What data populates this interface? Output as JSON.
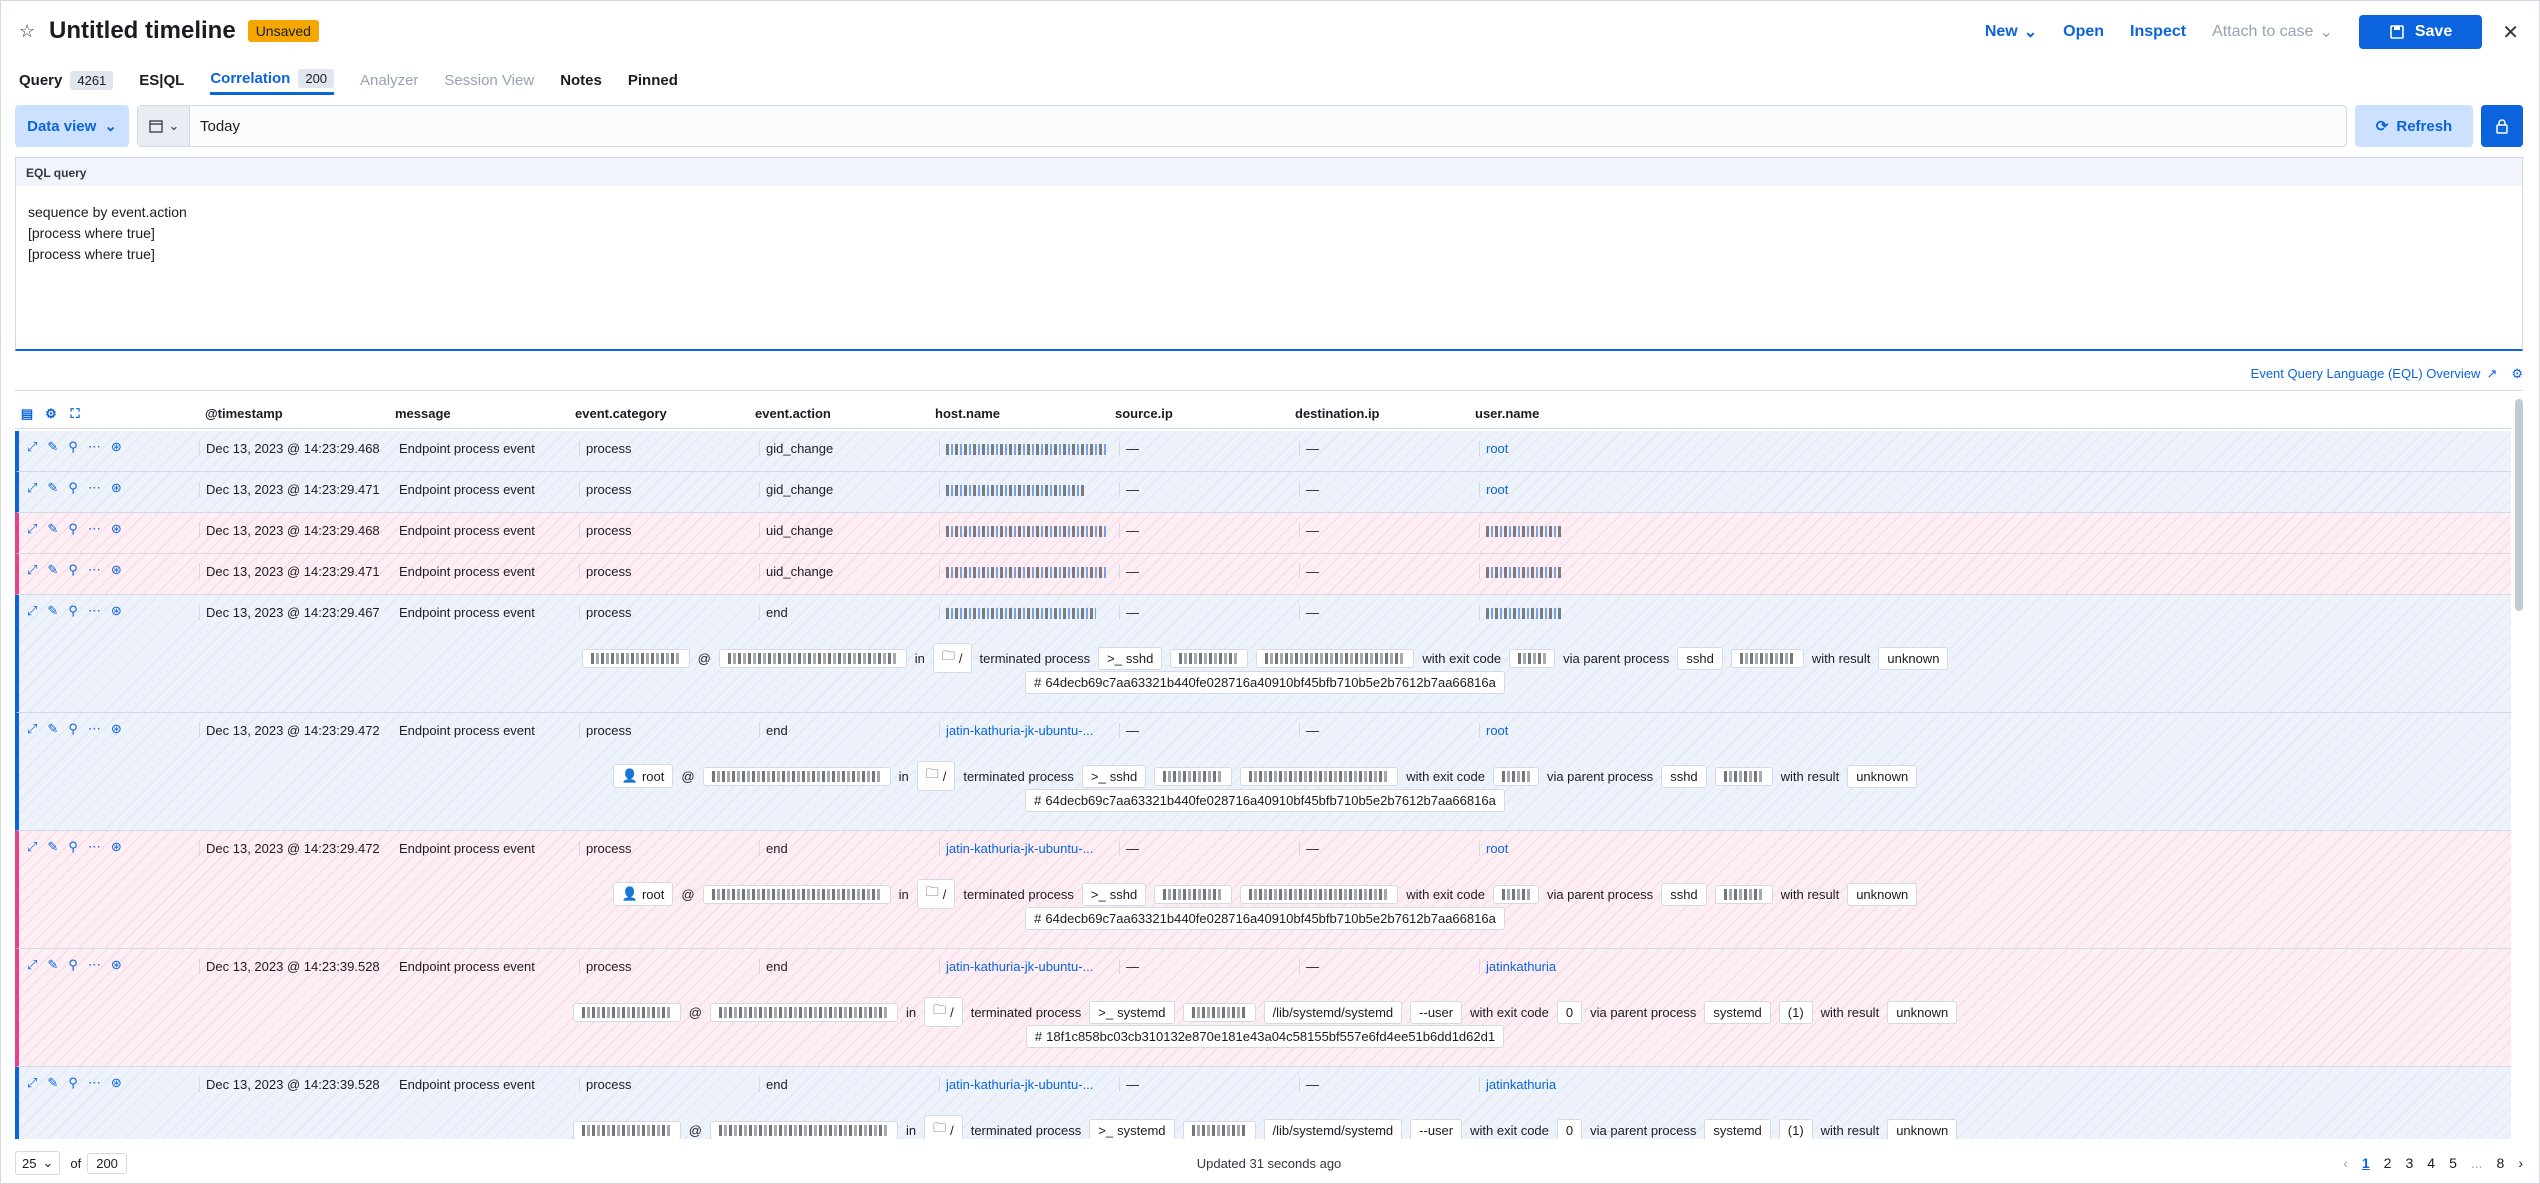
{
  "header": {
    "title": "Untitled timeline",
    "unsaved_badge": "Unsaved",
    "new_label": "New",
    "open_label": "Open",
    "inspect_label": "Inspect",
    "attach_label": "Attach to case",
    "save_label": "Save"
  },
  "tabs": [
    {
      "label": "Query",
      "count": "4261"
    },
    {
      "label": "ES|QL"
    },
    {
      "label": "Correlation",
      "count": "200"
    },
    {
      "label": "Analyzer"
    },
    {
      "label": "Session View"
    },
    {
      "label": "Notes"
    },
    {
      "label": "Pinned"
    }
  ],
  "query_bar": {
    "data_view_label": "Data view",
    "date_value": "Today",
    "refresh_label": "Refresh"
  },
  "eql": {
    "label": "EQL query",
    "query": "sequence by event.action\n[process where true]\n[process where true]",
    "overview_link": "Event Query Language (EQL) Overview"
  },
  "columns": [
    "@timestamp",
    "message",
    "event.category",
    "event.action",
    "host.name",
    "source.ip",
    "destination.ip",
    "user.name"
  ],
  "rows": [
    {
      "ts": "Dec 13, 2023 @ 14:23:29.468",
      "msg": "Endpoint process event",
      "cat": "process",
      "action": "gid_change",
      "host": "",
      "src": "—",
      "dst": "—",
      "user": "root",
      "color": "blue"
    },
    {
      "ts": "Dec 13, 2023 @ 14:23:29.471",
      "msg": "Endpoint process event",
      "cat": "process",
      "action": "gid_change",
      "host": "",
      "src": "—",
      "dst": "—",
      "user": "root",
      "color": "blue"
    },
    {
      "ts": "Dec 13, 2023 @ 14:23:29.468",
      "msg": "Endpoint process event",
      "cat": "process",
      "action": "uid_change",
      "host": "",
      "src": "—",
      "dst": "—",
      "user": "",
      "color": "pink"
    },
    {
      "ts": "Dec 13, 2023 @ 14:23:29.471",
      "msg": "Endpoint process event",
      "cat": "process",
      "action": "uid_change",
      "host": "",
      "src": "—",
      "dst": "—",
      "user": "",
      "color": "pink"
    },
    {
      "ts": "Dec 13, 2023 @ 14:23:29.467",
      "msg": "Endpoint process event",
      "cat": "process",
      "action": "end",
      "host": "",
      "src": "—",
      "dst": "—",
      "user": "",
      "color": "blue",
      "renderer": {
        "user": "",
        "in": "in",
        "dir": "/",
        "terminated": "terminated process",
        "proc": "sshd",
        "exit": "with exit code",
        "via": "via parent process",
        "parent": "sshd",
        "result": "with result",
        "result_val": "unknown",
        "hash": "64decb69c7aa63321b440fe028716a40910bf45bfb710b5e2b7612b7aa66816a"
      }
    },
    {
      "ts": "Dec 13, 2023 @ 14:23:29.472",
      "msg": "Endpoint process event",
      "cat": "process",
      "action": "end",
      "host": "jatin-kathuria-jk-ubuntu-...",
      "src": "—",
      "dst": "—",
      "user": "root",
      "color": "blue",
      "renderer": {
        "user": "root",
        "in": "in",
        "dir": "/",
        "terminated": "terminated process",
        "proc": "sshd",
        "exit": "with exit code",
        "via": "via parent process",
        "parent": "sshd",
        "result": "with result",
        "result_val": "unknown",
        "hash": "64decb69c7aa63321b440fe028716a40910bf45bfb710b5e2b7612b7aa66816a"
      }
    },
    {
      "ts": "Dec 13, 2023 @ 14:23:29.472",
      "msg": "Endpoint process event",
      "cat": "process",
      "action": "end",
      "host": "jatin-kathuria-jk-ubuntu-...",
      "src": "—",
      "dst": "—",
      "user": "root",
      "color": "pink",
      "renderer": {
        "user": "root",
        "in": "in",
        "dir": "/",
        "terminated": "terminated process",
        "proc": "sshd",
        "exit": "with exit code",
        "via": "via parent process",
        "parent": "sshd",
        "result": "with result",
        "result_val": "unknown",
        "hash": "64decb69c7aa63321b440fe028716a40910bf45bfb710b5e2b7612b7aa66816a"
      }
    },
    {
      "ts": "Dec 13, 2023 @ 14:23:39.528",
      "msg": "Endpoint process event",
      "cat": "process",
      "action": "end",
      "host": "jatin-kathuria-jk-ubuntu-...",
      "src": "—",
      "dst": "—",
      "user": "jatinkathuria",
      "color": "pink",
      "renderer": {
        "user": "",
        "in": "in",
        "dir": "/",
        "terminated": "terminated process",
        "proc": "systemd",
        "path": "/lib/systemd/systemd",
        "arg": "--user",
        "exit": "with exit code",
        "code": "0",
        "via": "via parent process",
        "parent": "systemd",
        "pid": "(1)",
        "result": "with result",
        "result_val": "unknown",
        "hash": "18f1c858bc03cb310132e870e181e43a04c58155bf557e6fd4ee51b6dd1d62d1"
      }
    },
    {
      "ts": "Dec 13, 2023 @ 14:23:39.528",
      "msg": "Endpoint process event",
      "cat": "process",
      "action": "end",
      "host": "jatin-kathuria-jk-ubuntu-...",
      "src": "—",
      "dst": "—",
      "user": "jatinkathuria",
      "color": "blue",
      "renderer": {
        "user": "",
        "in": "in",
        "dir": "/",
        "terminated": "terminated process",
        "proc": "systemd",
        "path": "/lib/systemd/systemd",
        "arg": "--user",
        "exit": "with exit code",
        "code": "0",
        "via": "via parent process",
        "parent": "systemd",
        "pid": "(1)",
        "result": "with result",
        "result_val": "unknown"
      }
    }
  ],
  "footer": {
    "per_page": "25",
    "of_label": "of",
    "total": "200",
    "updated": "Updated 31 seconds ago",
    "pages": [
      "1",
      "2",
      "3",
      "4",
      "5",
      "...",
      "8"
    ]
  },
  "colors": {
    "accent": "#0b64dd",
    "pink": "#e7418a",
    "unsaved": "#f5a700"
  },
  "icons": [
    "star-icon",
    "chevron-down-icon",
    "save-icon",
    "close-icon",
    "calendar-icon",
    "refresh-icon",
    "lock-icon",
    "expand-icon",
    "note-icon",
    "pin-icon",
    "more-icon",
    "analyze-icon",
    "hash-icon",
    "external-link-icon"
  ]
}
